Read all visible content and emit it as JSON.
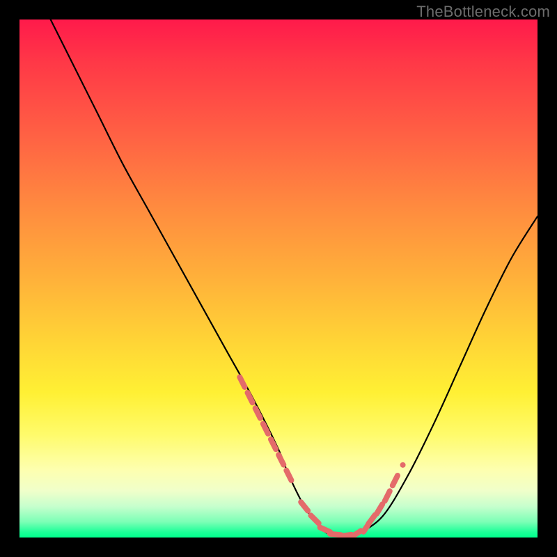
{
  "watermark": "TheBottleneck.com",
  "chart_data": {
    "type": "line",
    "title": "",
    "xlabel": "",
    "ylabel": "",
    "xlim": [
      0,
      100
    ],
    "ylim": [
      0,
      100
    ],
    "grid": false,
    "legend": false,
    "series": [
      {
        "name": "main-curve",
        "color": "#000000",
        "x": [
          6,
          10,
          15,
          20,
          25,
          30,
          35,
          40,
          45,
          50,
          52,
          55,
          58,
          60,
          63,
          65,
          70,
          75,
          80,
          85,
          90,
          95,
          100
        ],
        "y": [
          100,
          92,
          82,
          72,
          63,
          54,
          45,
          36,
          27,
          17,
          12,
          6,
          2,
          0.6,
          0.3,
          0.6,
          4,
          12,
          22,
          33,
          44,
          54,
          62
        ]
      },
      {
        "name": "highlight-dots",
        "color": "#e46a6a",
        "x": [
          43,
          44.5,
          46,
          47.5,
          49,
          50.5,
          52,
          55,
          57,
          59,
          61,
          63,
          65,
          67,
          68,
          69.5,
          71,
          72.5,
          74
        ],
        "y": [
          30,
          27,
          24,
          21,
          18,
          15,
          12,
          6,
          3.5,
          1.5,
          0.6,
          0.4,
          0.7,
          2,
          3.5,
          5.5,
          8,
          11,
          14
        ]
      }
    ],
    "background_gradient_stops": [
      {
        "pos": 0,
        "color": "#ff1a4b"
      },
      {
        "pos": 8,
        "color": "#ff3747"
      },
      {
        "pos": 22,
        "color": "#ff6044"
      },
      {
        "pos": 36,
        "color": "#ff8a3f"
      },
      {
        "pos": 50,
        "color": "#ffb13a"
      },
      {
        "pos": 62,
        "color": "#ffd436"
      },
      {
        "pos": 72,
        "color": "#fff034"
      },
      {
        "pos": 80,
        "color": "#fffb6a"
      },
      {
        "pos": 87,
        "color": "#fdffb0"
      },
      {
        "pos": 91,
        "color": "#f0ffca"
      },
      {
        "pos": 94,
        "color": "#c6ffcd"
      },
      {
        "pos": 97,
        "color": "#7bffb6"
      },
      {
        "pos": 99,
        "color": "#1aff97"
      },
      {
        "pos": 100,
        "color": "#00ff8d"
      }
    ]
  }
}
